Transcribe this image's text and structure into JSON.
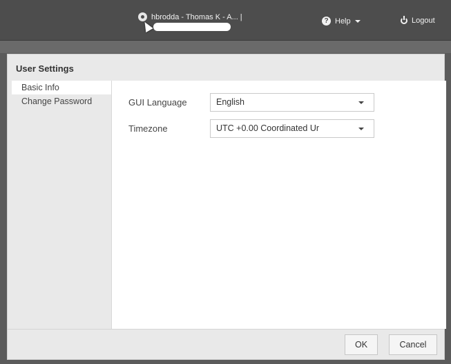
{
  "header": {
    "user_name": "hbrodda - Thomas K - A... |",
    "help_label": "Help",
    "logout_label": "Logout"
  },
  "dialog": {
    "title": "User Settings",
    "nav": [
      {
        "label": "Basic Info",
        "active": true
      },
      {
        "label": "Change Password",
        "active": false
      }
    ],
    "fields": [
      {
        "label": "GUI Language",
        "value": "English"
      },
      {
        "label": "Timezone",
        "value": "UTC +0.00 Coordinated Ur"
      }
    ],
    "buttons": {
      "ok": "OK",
      "cancel": "Cancel"
    }
  }
}
